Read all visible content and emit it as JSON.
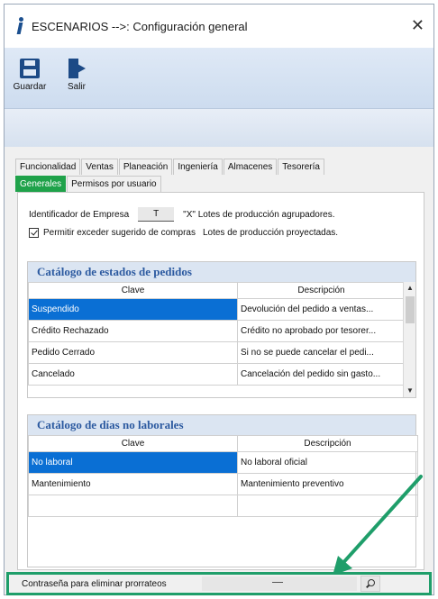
{
  "window": {
    "title": "ESCENARIOS -->: Configuración general",
    "close": "✕"
  },
  "toolbar": {
    "save_label": "Guardar",
    "exit_label": "Salir"
  },
  "tabs": {
    "row1": [
      "Funcionalidad",
      "Ventas",
      "Planeación",
      "Ingeniería",
      "Almacenes",
      "Tesorería"
    ],
    "row2": [
      "Generales",
      "Permisos por usuario"
    ],
    "active": "Generales"
  },
  "options": {
    "company_id_label": "Identificador de Empresa",
    "company_id_value": "T",
    "lots_grouped_label": "\"X\" Lotes de producción agrupadores.",
    "allow_exceed_label": "Permitir exceder sugerido de compras",
    "allow_exceed_checked": true,
    "lots_projected_label": "Lotes de producción proyectadas."
  },
  "order_states": {
    "title": "Catálogo de estados de pedidos",
    "columns": [
      "Clave",
      "Descripción"
    ],
    "rows": [
      {
        "key": "Suspendido",
        "desc": "Devolución del pedido a ventas..."
      },
      {
        "key": "Crédito Rechazado",
        "desc": "Crédito no aprobado por tesorer..."
      },
      {
        "key": "Pedido Cerrado",
        "desc": "Si no se puede cancelar el pedi..."
      },
      {
        "key": "Cancelado",
        "desc": "Cancelación del pedido sin gasto..."
      }
    ]
  },
  "non_working_days": {
    "title": "Catálogo de días no laborales",
    "columns": [
      "Clave",
      "Descripción"
    ],
    "rows": [
      {
        "key": "No laboral",
        "desc": "No laboral oficial"
      },
      {
        "key": "Mantenimiento",
        "desc": "Mantenimiento preventivo"
      },
      {
        "key": "",
        "desc": ""
      }
    ]
  },
  "footer": {
    "label": "Contraseña para eliminar prorrateos"
  },
  "colors": {
    "selection": "#0a6fd4",
    "highlight_green": "#1f9e6a",
    "active_tab": "#1fa24a"
  }
}
